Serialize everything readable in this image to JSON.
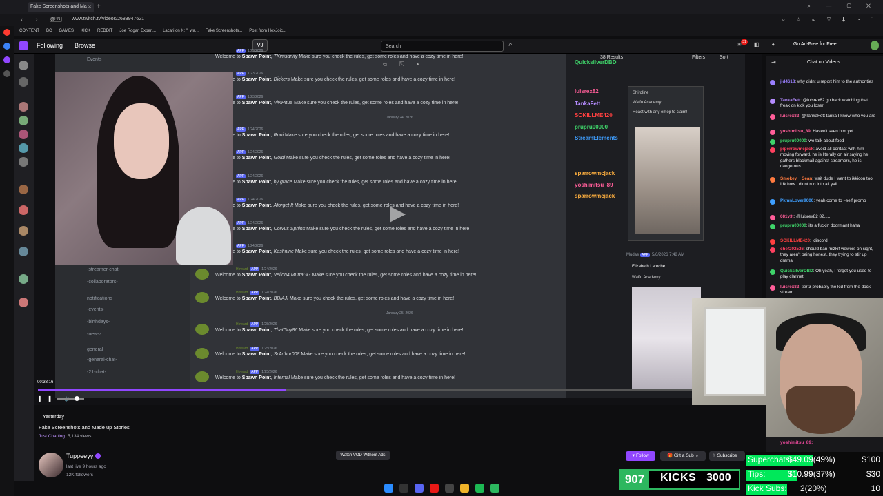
{
  "browser": {
    "tab_title": "Fake Screenshots and Ma",
    "url": "www.twitch.tv/videos/2683947621",
    "vpn_label": "VPN",
    "bookmarks": [
      "CONTENT",
      "BC",
      "GAMES",
      "KICK",
      "REDDIT",
      "Joe Rogan Experi...",
      "Lacari on X: \"I wa...",
      "Fake Screenshots...",
      "Post from HexJoic..."
    ]
  },
  "twitch_header": {
    "following": "Following",
    "browse": "Browse",
    "search_placeholder": "Search",
    "notification_count": "31",
    "ad_free": "Go Ad-Free for Free"
  },
  "discord": {
    "channels": [
      "Events",
      "-streamer-chat-",
      "-collaborators-",
      "notifications",
      "-events-",
      "-birthdays-",
      "-news-",
      "general",
      "-general-chat-",
      "-21-chat-"
    ],
    "messages": [
      {
        "user": "Spawn Point",
        "name": "TKimsanity",
        "date": "1/23/2026"
      },
      {
        "user": "Spawn Point",
        "name": "Dickers",
        "date": "1/23/2026"
      },
      {
        "user": "Spawn Point",
        "name": "ViviRitua",
        "date": "1/23/2026"
      },
      {
        "user": "Spawn Point",
        "name": "Roni",
        "date": "1/24/2026"
      },
      {
        "user": "Spawn Point",
        "name": "Goldi",
        "date": "1/24/2026"
      },
      {
        "user": "Spawn Point",
        "name": "by grace",
        "date": "1/24/2026"
      },
      {
        "user": "Spawn Point",
        "name": "Aforget It",
        "date": "1/24/2026"
      },
      {
        "user": "Spawn Point",
        "name": "Corvus Sphinx",
        "date": "1/24/2026"
      },
      {
        "user": "Spawn Point",
        "name": "Kashnine",
        "date": "1/24/2026"
      },
      {
        "user": "Spawn Point",
        "name": "Velion4 MurtaGG",
        "date": "1/24/2026"
      },
      {
        "user": "Spawn Point",
        "name": "BBIAJI",
        "date": "1/24/2026"
      },
      {
        "user": "Spawn Point",
        "name": "ThatGuy86",
        "date": "1/25/2026"
      },
      {
        "user": "Spawn Point",
        "name": "SrArthur008",
        "date": "1/25/2026"
      },
      {
        "user": "Spawn Point",
        "name": "Infernal",
        "date": "1/25/2026"
      }
    ],
    "msg_prefix": "Welcome to ",
    "msg_suffix": " Make sure you check the rules, get some roles and have a cozy time in here!",
    "bot_name": "Howard",
    "app_badge": "APP",
    "date_dividers": [
      "January 24, 2026",
      "January 25, 2026"
    ],
    "results": "38 Results",
    "filters": "Filters",
    "sort": "Sort",
    "right_names": [
      "QuicksilverDBD",
      "luisrex82",
      "TankaFett",
      "SOKILLME420",
      "pruрru00000",
      "StreamElements",
      "sparrowmcjack",
      "yoshimitsu_89",
      "sparrowmcjack"
    ],
    "popup_title": "Shiroline",
    "popup_sub": "Waifu Academy",
    "popup_react": "React with any emoji to claim!",
    "mudae": "Mudae",
    "mudae_date": "5/6/2026 7:48 AM",
    "card_name": "Elizabeth Laroche",
    "card_sub": "Waifu Academy"
  },
  "player": {
    "timecode": "00:33:16",
    "progress": 0.38
  },
  "chat": {
    "title": "Chat on Videos",
    "lines": [
      {
        "name": "jid4618",
        "text": "why didnt u report him to the authorities",
        "color": "#9a7fff"
      },
      {
        "name": "TankaFett",
        "text": "@luisrex82 go back watching that freak on kick you loser",
        "color": "#b58cff"
      },
      {
        "name": "luisrex82",
        "text": "@TankaFett tanka I know who you are",
        "color": "#ff5e99"
      },
      {
        "name": "yoshimitsu_89",
        "text": "Haven't seen him yet",
        "color": "#ff5e99"
      },
      {
        "name": "prupru00000",
        "text": "we talk about food",
        "color": "#3fd46a"
      },
      {
        "name": "piperrowmcjack",
        "text": "avoid all contact with him moving forward, he is literally on air saying he gathers blackmail against streamers, he is dangerous",
        "color": "#ff4060"
      },
      {
        "name": "Smokey__Sean",
        "text": "wait dude I went to ikkicon too! Idk how I didnt run into all yall",
        "color": "#ff7a3f"
      },
      {
        "name": "PkmnLover9000",
        "text": "yeah come to ~self promo",
        "color": "#3f9fff"
      },
      {
        "name": "081v3t",
        "text": "@luisrex82 82.....",
        "color": "#ff5e99"
      },
      {
        "name": "prupru00000",
        "text": "its a fuckin doormant haha",
        "color": "#3fd46a"
      },
      {
        "name": "SOKILLME420",
        "text": "Idiscord",
        "color": "#ff4040"
      },
      {
        "name": "chef202526",
        "text": "should ban mizkif viewers on sight, they aren't being honest. they trying to stir up drama",
        "color": "#ff4060"
      },
      {
        "name": "QuicksilverDBD",
        "text": "Oh yeah, I forgot you used to play clarinet",
        "color": "#3fd46a"
      },
      {
        "name": "luisrex82",
        "text": "tier 3 probably the kid from the dock stream",
        "color": "#ff5e99"
      }
    ],
    "last_line": "yoshimitsu_89:"
  },
  "video_info": {
    "date": "Yesterday",
    "title": "Fake Screenshots and Made up Stories",
    "category": "Just Chatting",
    "views": "5,134 views",
    "channel": "Tuppeeyy",
    "last_live": "last live 9 hours ago",
    "followers": "12K followers",
    "watch_vod": "Watch VOD Without Ads",
    "follow": "Follow",
    "gift": "Gift a Sub",
    "subscribe": "Subscribe"
  },
  "overlay": {
    "kicks_count": "907",
    "kicks_label": "KICKS",
    "kicks_target": "3000",
    "goals": [
      {
        "label": "Superchats:",
        "value": "$49.09(49%)",
        "target": "$100",
        "fraction": 0.49
      },
      {
        "label": "Tips:",
        "value": "$10.99(37%)",
        "target": "$30",
        "fraction": 0.37
      },
      {
        "label": "Kick Subs:",
        "value": "2(20%)",
        "target": "10",
        "fraction": 0.2
      }
    ]
  },
  "colors": {
    "twitch_purple": "#9147ff",
    "kick_green": "#2db75f",
    "goal_green": "#00e85a"
  }
}
